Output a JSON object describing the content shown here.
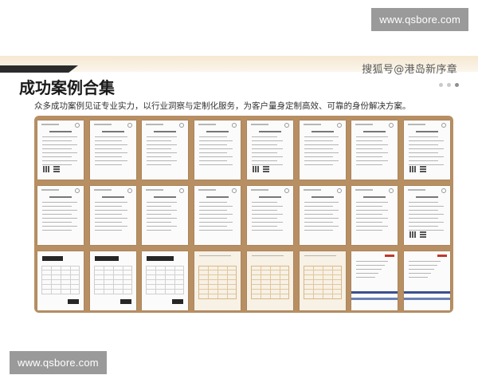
{
  "watermarks": {
    "top": "www.qsbore.com",
    "bottom": "www.qsbore.com"
  },
  "slide": {
    "brand": "搜狐号@港岛新序章",
    "title": "成功案例合集",
    "subtitle": "众多成功案例见证专业实力，以行业洞察与定制化服务，为客户量身定制高效、可靠的身份解决方案。",
    "page_dots": 3,
    "active_dot": 2
  },
  "colors": {
    "board": "#b78f63",
    "header_band": "#f6e8d2",
    "accent_bar": "#2b2b2b",
    "watermark_bg": "#9a9a9a"
  },
  "documents": {
    "rows": [
      [
        "letter-qr",
        "letter",
        "letter",
        "letter",
        "letter-qr",
        "letter",
        "letter",
        "letter-qr"
      ],
      [
        "letter",
        "letter",
        "letter",
        "letter",
        "letter",
        "letter",
        "letter",
        "letter-qr"
      ],
      [
        "form-redacted",
        "form-redacted",
        "form-redacted",
        "form-warm",
        "form-warm",
        "form-warm",
        "form-blue",
        "form-blue"
      ]
    ]
  }
}
